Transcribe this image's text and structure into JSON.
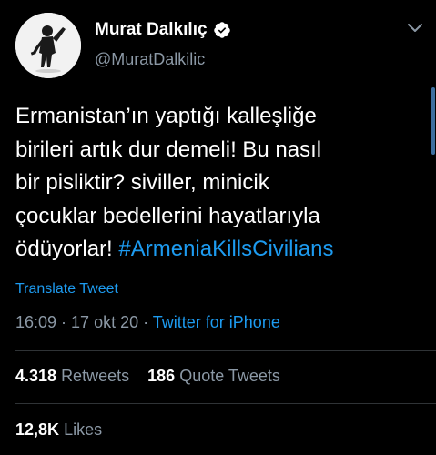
{
  "author": {
    "display_name": "Murat Dalkılıç",
    "handle": "@MuratDalkilic",
    "verified_icon": "verified-badge-icon",
    "avatar_icon": "avatar-photo"
  },
  "tweet": {
    "lines": [
      "Ermanistan’ın yaptığı kalleşliğe",
      "birileri artık dur demeli! Bu nasıl",
      "bir pisliktir? siviller, minicik",
      "çocuklar bedellerini hayatlarıyla",
      "ödüyorlar! "
    ],
    "hashtag": "#ArmeniaKillsCivilians",
    "translate_label": "Translate Tweet"
  },
  "meta": {
    "time": "16:09",
    "date": "17 okt 20",
    "separator": " · ",
    "source": "Twitter for iPhone"
  },
  "stats": {
    "retweets_count": "4.318",
    "retweets_label": "Retweets",
    "quote_count": "186",
    "quote_label": "Quote Tweets",
    "likes_count": "12,8K",
    "likes_label": "Likes"
  },
  "colors": {
    "background": "#000000",
    "text": "#ffffff",
    "secondary": "#8b98a5",
    "accent": "#1d9bf0",
    "divider": "#2f3336"
  }
}
